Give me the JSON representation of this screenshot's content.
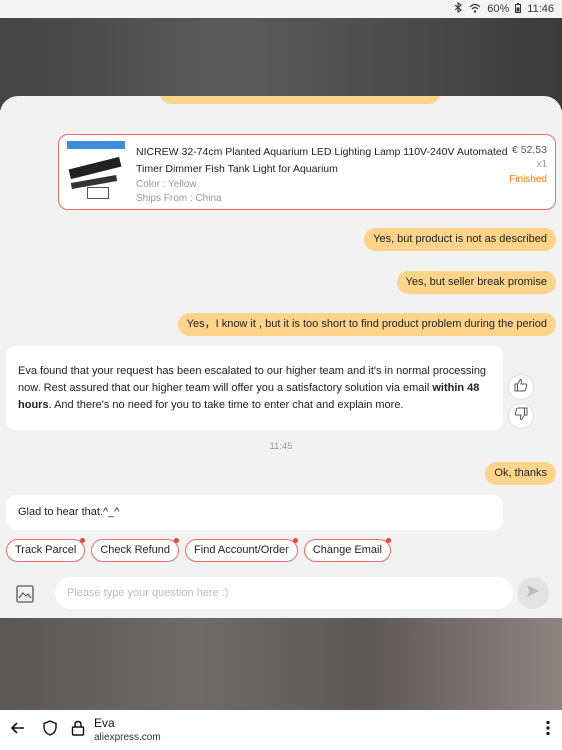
{
  "status_bar": {
    "battery": "60%",
    "time": "11:46"
  },
  "product": {
    "title": "NICREW 32-74cm Planted Aquarium LED Lighting Lamp 110V-240V Automated Timer Dimmer Fish Tank Light for Aquarium",
    "color": "Color : Yellow",
    "ships_from": "Ships From : China",
    "price": "€ 52,53",
    "quantity": "x1",
    "status": "Finished"
  },
  "messages": {
    "user_1": "Yes, but product is not as described",
    "user_2": "Yes, but seller break promise",
    "user_3": "Yes，I know it , but it is too short to find product problem during the period",
    "bot_1_part1": "Eva found that your request has been escalated to our higher team and it's in normal processing now. Rest assured that our higher team will offer you a satisfactory solution via email ",
    "bot_1_bold": "within 48 hours",
    "bot_1_part2": ". And there's no need for you to take time to enter chat and explain more.",
    "time": "11:45",
    "user_4": "Ok, thanks",
    "bot_2": "Glad to hear that.^_^"
  },
  "quick_replies": [
    "Track Parcel",
    "Check Refund",
    "Find Account/Order",
    "Change Email"
  ],
  "input": {
    "placeholder": "Please type your question here :)"
  },
  "browser": {
    "page_name": "Eva",
    "url": "aliexpress.com"
  },
  "colors": {
    "user_bubble": "#fdd48a",
    "chip_border": "#ef6868",
    "status_finished": "#ff7a00"
  }
}
